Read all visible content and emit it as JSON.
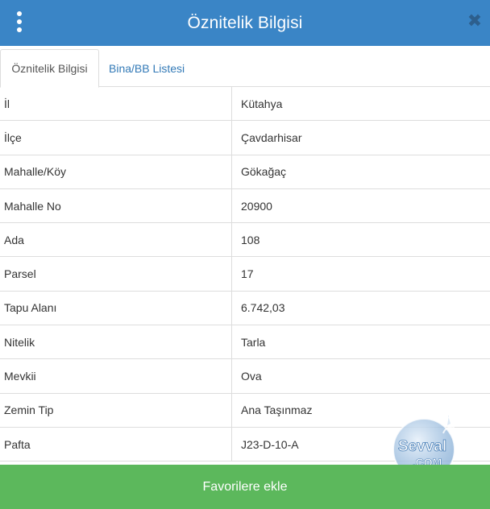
{
  "header": {
    "title": "Öznitelik Bilgisi"
  },
  "tabs": [
    {
      "label": "Öznitelik Bilgisi",
      "active": true
    },
    {
      "label": "Bina/BB Listesi",
      "active": false
    }
  ],
  "attributes": [
    {
      "key": "İl",
      "value": "Kütahya"
    },
    {
      "key": "İlçe",
      "value": "Çavdarhisar"
    },
    {
      "key": "Mahalle/Köy",
      "value": "Gökağaç"
    },
    {
      "key": "Mahalle No",
      "value": "20900"
    },
    {
      "key": "Ada",
      "value": "108"
    },
    {
      "key": "Parsel",
      "value": "17"
    },
    {
      "key": "Tapu Alanı",
      "value": "6.742,03"
    },
    {
      "key": "Nitelik",
      "value": "Tarla"
    },
    {
      "key": "Mevkii",
      "value": "Ova"
    },
    {
      "key": "Zemin Tip",
      "value": "Ana Taşınmaz"
    },
    {
      "key": "Pafta",
      "value": "J23-D-10-A"
    }
  ],
  "footer": {
    "button_label": "Favorilere ekle"
  },
  "watermark": {
    "line1": "Sevval",
    "line2": ".COM"
  },
  "colors": {
    "header": "#3a85c6",
    "footer": "#5cb85c",
    "tab_link": "#337ab7"
  }
}
